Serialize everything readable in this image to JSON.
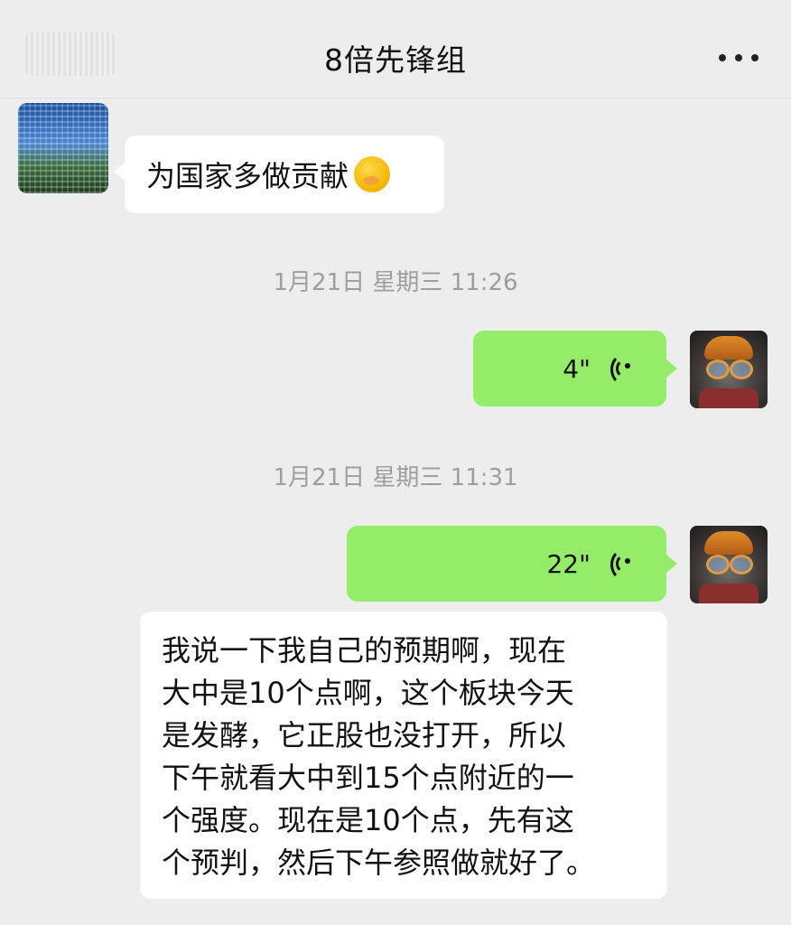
{
  "header": {
    "title": "8倍先锋组",
    "more_icon": "more-horizontal-icon"
  },
  "messages": [
    {
      "type": "text",
      "side": "left",
      "text": "为国家多做贡献",
      "emoji": "hand-over-mouth-emoji"
    },
    {
      "type": "timestamp",
      "text": "1月21日 星期三 11:26"
    },
    {
      "type": "voice",
      "side": "right",
      "duration": "4\""
    },
    {
      "type": "timestamp",
      "text": "1月21日 星期三 11:31"
    },
    {
      "type": "voice",
      "side": "right",
      "duration": "22\""
    },
    {
      "type": "transcript",
      "lines": [
        "我说一下我自己的预期啊，现在",
        "大中是10个点啊，这个板块今天",
        "是发酵，它正股也没打开，所以",
        "下午就看大中到15个点附近的一",
        "个强度。现在是10个点，先有这",
        "个预判，然后下午参照做就好了。"
      ]
    }
  ],
  "colors": {
    "background": "#ededed",
    "bubble_self": "#95ec69",
    "bubble_other": "#ffffff",
    "timestamp": "#9e9e9e"
  }
}
